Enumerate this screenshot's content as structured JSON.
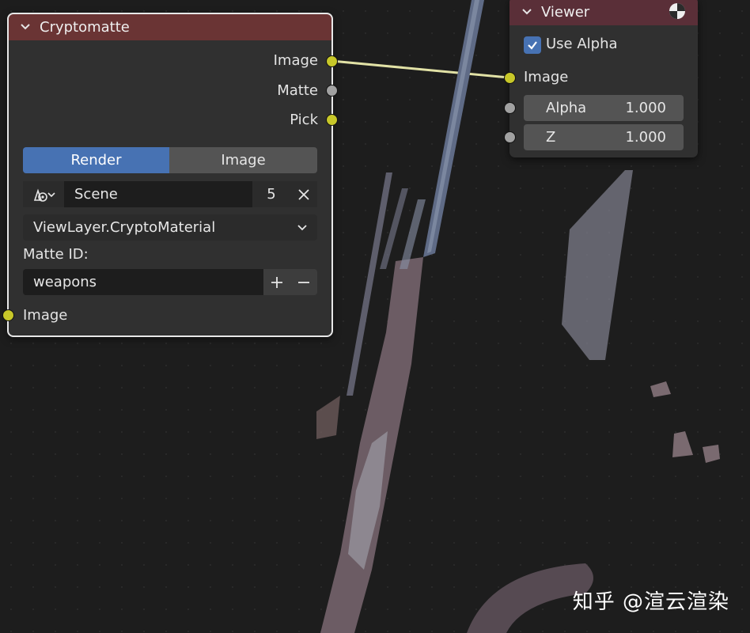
{
  "cryptomatte": {
    "title": "Cryptomatte",
    "outputs": [
      "Image",
      "Matte",
      "Pick"
    ],
    "tabs": [
      "Render",
      "Image"
    ],
    "scene": {
      "name": "Scene",
      "users": "5"
    },
    "layer": "ViewLayer.CryptoMaterial",
    "matte_id_label": "Matte ID:",
    "matte_id_value": "weapons",
    "input": "Image"
  },
  "viewer": {
    "title": "Viewer",
    "use_alpha_label": "Use Alpha",
    "use_alpha_checked": true,
    "input": "Image",
    "alpha": {
      "label": "Alpha",
      "value": "1.000"
    },
    "z": {
      "label": "Z",
      "value": "1.000"
    }
  },
  "watermark": "知乎 @渲云渲染",
  "colors": {
    "accent": "#4772b3",
    "socket_color": "#c7c729",
    "socket_value": "#a1a1a1",
    "crypto_header": "#6a3434",
    "viewer_header": "#5a2f38"
  }
}
